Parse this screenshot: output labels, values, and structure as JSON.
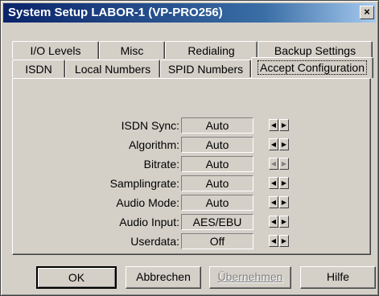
{
  "window": {
    "title": "System Setup  LABOR-1 (VP-PRO256)",
    "close_glyph": "×"
  },
  "tabs_back": [
    "I/O Levels",
    "Misc",
    "Redialing",
    "Backup Settings"
  ],
  "tabs_front": [
    "ISDN",
    "Local Numbers",
    "SPID Numbers",
    "Accept Configuration"
  ],
  "active_tab": "Accept Configuration",
  "settings": [
    {
      "label": "ISDN Sync:",
      "value": "Auto",
      "arrows_enabled": true
    },
    {
      "label": "Algorithm:",
      "value": "Auto",
      "arrows_enabled": true
    },
    {
      "label": "Bitrate:",
      "value": "Auto",
      "arrows_enabled": false
    },
    {
      "label": "Samplingrate:",
      "value": "Auto",
      "arrows_enabled": true
    },
    {
      "label": "Audio Mode:",
      "value": "Auto",
      "arrows_enabled": true
    },
    {
      "label": "Audio Input:",
      "value": "AES/EBU",
      "arrows_enabled": true
    },
    {
      "label": "Userdata:",
      "value": "Off",
      "arrows_enabled": true
    }
  ],
  "arrows": {
    "left": "◀",
    "right": "▶"
  },
  "buttons": {
    "ok": "OK",
    "cancel": "Abbrechen",
    "apply": "Übernehmen",
    "help": "Hilfe"
  },
  "icons": [
    "close-icon",
    "arrow-left-icon",
    "arrow-right-icon"
  ]
}
